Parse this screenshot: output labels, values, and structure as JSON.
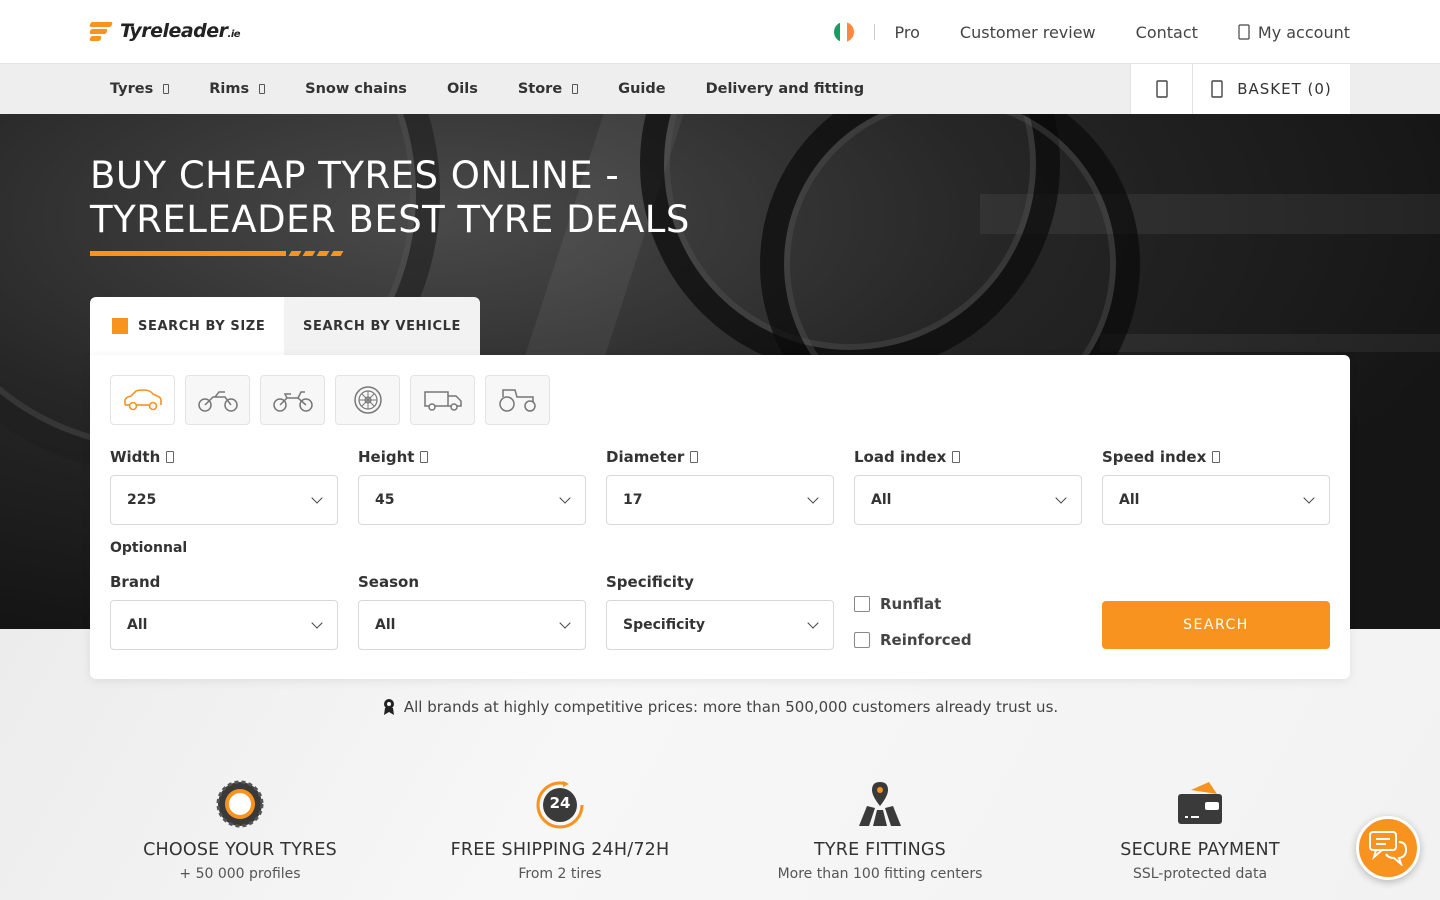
{
  "header": {
    "logo_text": "Tyreleader",
    "logo_suffix": ".ie",
    "links": [
      "Pro",
      "Customer review",
      "Contact"
    ],
    "account_label": "My account"
  },
  "nav": {
    "items": [
      {
        "label": "Tyres",
        "has_dropdown": true
      },
      {
        "label": "Rims",
        "has_dropdown": true
      },
      {
        "label": "Snow chains",
        "has_dropdown": false
      },
      {
        "label": "Oils",
        "has_dropdown": false
      },
      {
        "label": "Store",
        "has_dropdown": true
      },
      {
        "label": "Guide",
        "has_dropdown": false
      },
      {
        "label": "Delivery and fitting",
        "has_dropdown": false
      }
    ],
    "basket_label": "BASKET (0)"
  },
  "hero": {
    "title_line1": "BUY CHEAP TYRES ONLINE -",
    "title_line2": "TYRELEADER BEST TYRE DEALS"
  },
  "search": {
    "tabs": {
      "by_size": "SEARCH BY SIZE",
      "by_vehicle": "SEARCH BY VEHICLE"
    },
    "vehicle_icons": [
      "car-icon",
      "scooter-icon",
      "motorcycle-icon",
      "wheel-icon",
      "van-icon",
      "tractor-icon"
    ],
    "fields": {
      "width": {
        "label": "Width",
        "value": "225"
      },
      "height": {
        "label": "Height",
        "value": "45"
      },
      "diameter": {
        "label": "Diameter",
        "value": "17"
      },
      "load_index": {
        "label": "Load index",
        "value": "All"
      },
      "speed_index": {
        "label": "Speed index",
        "value": "All"
      }
    },
    "optional_label": "Optionnal",
    "optional_fields": {
      "brand": {
        "label": "Brand",
        "value": "All"
      },
      "season": {
        "label": "Season",
        "value": "All"
      },
      "specificity": {
        "label": "Specificity",
        "value": "Specificity"
      }
    },
    "checkboxes": {
      "runflat": "Runflat",
      "reinforced": "Reinforced"
    },
    "button": "SEARCH"
  },
  "trust_text": "All brands at highly competitive prices: more than 500,000 customers already trust us.",
  "features": [
    {
      "icon": "tyre-icon",
      "title": "CHOOSE YOUR TYRES",
      "subtitle": "+ 50 000 profiles"
    },
    {
      "icon": "shipping-24-icon",
      "title": "FREE SHIPPING 24H/72H",
      "subtitle": "From 2 tires",
      "badge": "24"
    },
    {
      "icon": "map-pin-icon",
      "title": "TYRE FITTINGS",
      "subtitle": "More than 100 fitting centers"
    },
    {
      "icon": "wallet-icon",
      "title": "SECURE PAYMENT",
      "subtitle": "SSL-protected data"
    }
  ],
  "colors": {
    "accent": "#f7931e",
    "text": "#333333",
    "hero_dark": "#1e1e1e"
  }
}
